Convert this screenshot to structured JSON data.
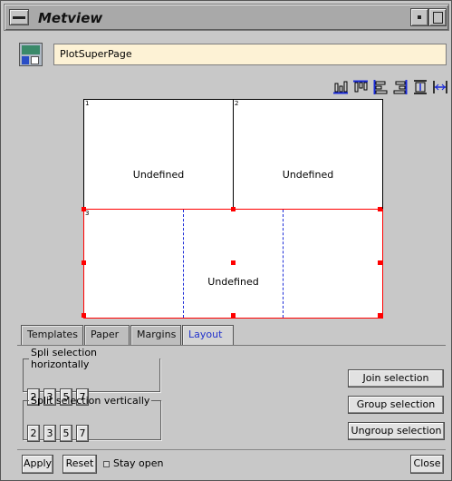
{
  "window": {
    "title": "Metview"
  },
  "header": {
    "name_value": "PlotSuperPage"
  },
  "toolbar": {
    "icons": [
      "align-bottom-icon",
      "align-top-icon",
      "align-left-icon",
      "align-right-icon",
      "equal-height-icon",
      "equal-width-icon"
    ]
  },
  "canvas": {
    "cells": [
      {
        "number": "1",
        "label": "Undefined"
      },
      {
        "number": "2",
        "label": "Undefined"
      },
      {
        "number": "3",
        "label": "Undefined"
      }
    ]
  },
  "tabs": [
    "Templates",
    "Paper",
    "Margins",
    "Layout"
  ],
  "active_tab": "Layout",
  "layout_panel": {
    "split_horizontal": {
      "legend": "Spli selection horizontally",
      "buttons": [
        "2",
        "3",
        "5",
        "7"
      ]
    },
    "split_vertical": {
      "legend": "Split selection vertically",
      "buttons": [
        "2",
        "3",
        "5",
        "7"
      ]
    },
    "join_label": "Join selection",
    "group_label": "Group selection",
    "ungroup_label": "Ungroup selection"
  },
  "footer": {
    "apply_label": "Apply",
    "reset_label": "Reset",
    "stay_open_label": "Stay open",
    "close_label": "Close"
  },
  "colors": {
    "selection": "#ff0000",
    "split_line": "#1b2bd8",
    "input_bg": "#fdf2d5",
    "active_tab_text": "#2233cc"
  }
}
